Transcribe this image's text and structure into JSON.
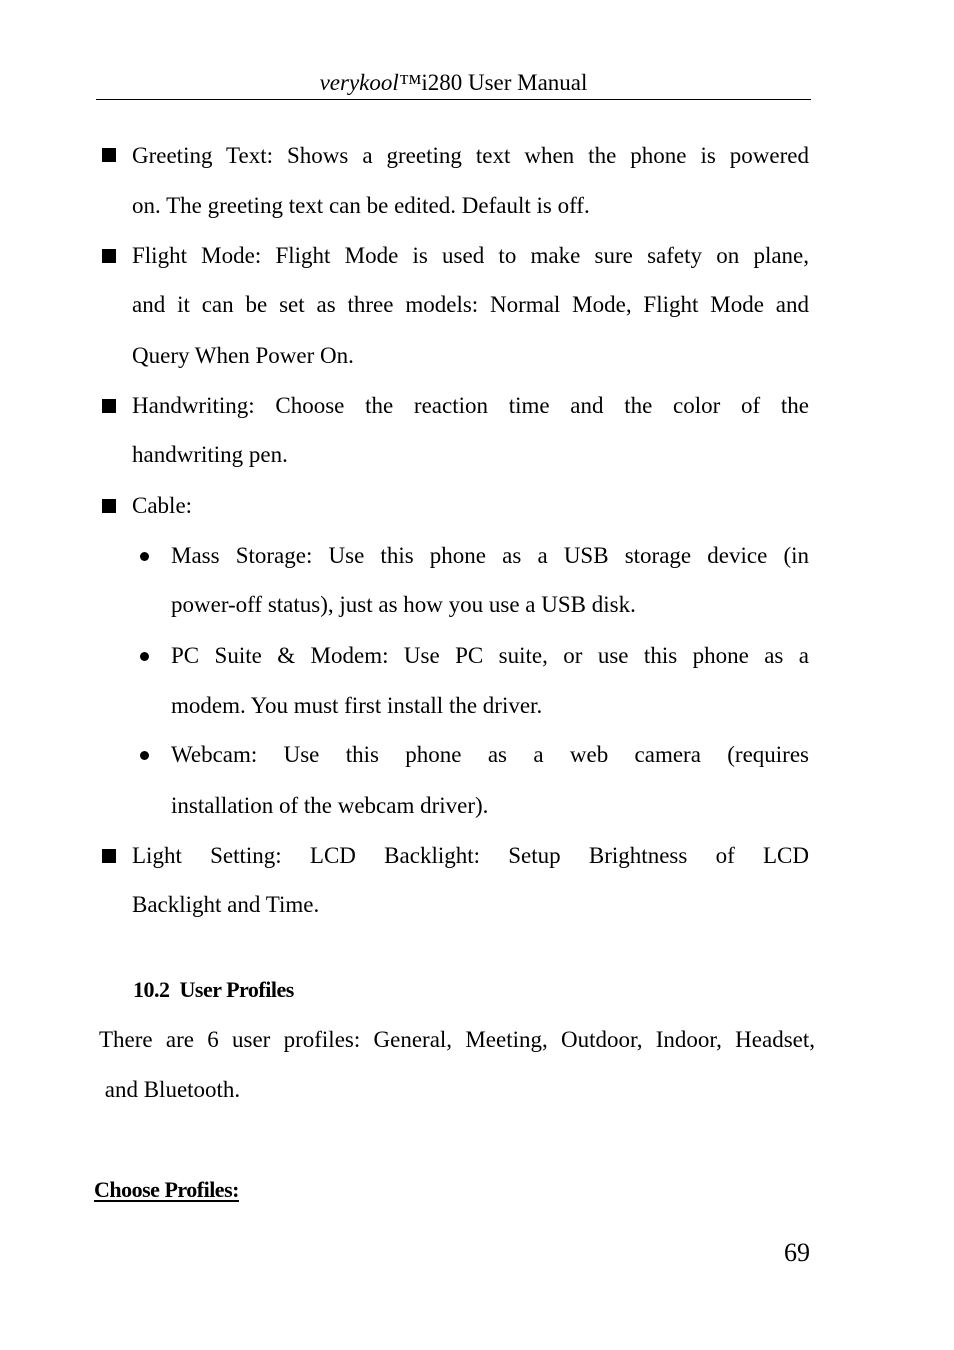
{
  "header": {
    "brand": "verykool™",
    "title": "i280 User Manual"
  },
  "items": [
    {
      "bullet": "square",
      "lines": [
        "Greeting Text: Shows a greeting text when the phone is powered",
        "on. The greeting text can be edited. Default is off."
      ]
    },
    {
      "bullet": "square",
      "lines": [
        "Flight Mode: Flight Mode is used to make sure safety on plane,",
        "and it can be set as three models: Normal Mode, Flight Mode and",
        "Query When Power On."
      ]
    },
    {
      "bullet": "square",
      "lines": [
        "Handwriting: Choose the reaction time and the color of the",
        "handwriting pen."
      ]
    },
    {
      "bullet": "square",
      "lines": [
        "Cable:"
      ],
      "subitems": [
        {
          "lines": [
            "Mass Storage: Use this phone as a USB storage device (in",
            "power-off status), just as how you use a USB disk."
          ]
        },
        {
          "lines": [
            "PC Suite & Modem: Use PC suite, or use this phone as a",
            "modem. You must first install the driver."
          ]
        },
        {
          "lines": [
            "Webcam: Use this phone as a web camera (requires",
            "installation of the webcam driver)."
          ]
        }
      ]
    },
    {
      "bullet": "square",
      "lines": [
        "Light Setting: LCD Backlight: Setup Brightness of LCD",
        "Backlight and Time."
      ]
    }
  ],
  "section": {
    "number": "10.2",
    "title": "User Profiles",
    "body_lines": [
      "There are 6 user profiles: General, Meeting, Outdoor, Indoor, Headset,",
      " and Bluetooth."
    ]
  },
  "subheading": "Choose Profiles:",
  "page_number": "69"
}
